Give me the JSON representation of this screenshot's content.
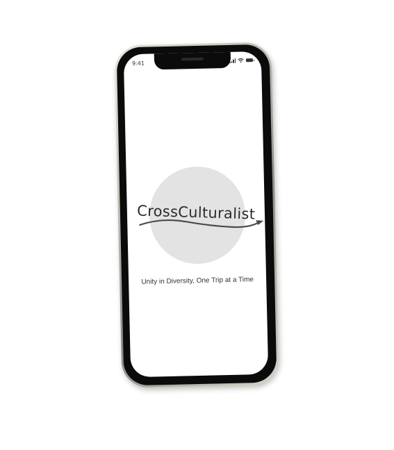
{
  "status_bar": {
    "time": "9:41"
  },
  "splash": {
    "logo_text": "CrossCulturalist",
    "tagline": "Unity in Diversity, One Trip at a Time"
  },
  "colors": {
    "logo_circle": "#e3e3e3",
    "text": "#333333",
    "phone_body": "#0b0b0b"
  },
  "icons": [
    "signal-icon",
    "wifi-icon",
    "battery-icon",
    "plane-swoosh-icon"
  ]
}
